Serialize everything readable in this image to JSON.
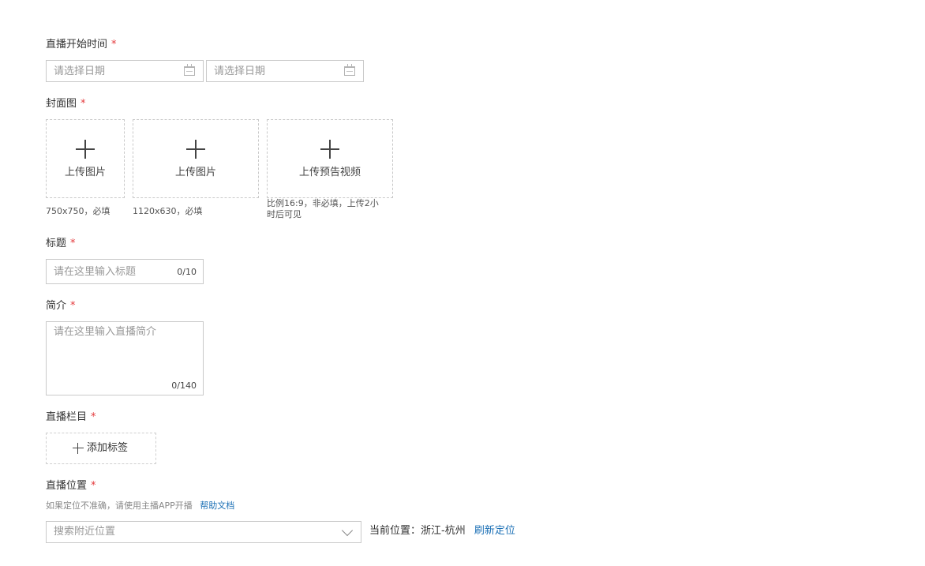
{
  "start_time": {
    "label": "直播开始时间",
    "required_mark": "*",
    "start_placeholder": "请选择日期",
    "end_placeholder": "请选择日期"
  },
  "cover": {
    "label": "封面图",
    "required_mark": "*",
    "uploads": [
      {
        "label": "上传图片",
        "hint": "750x750，必填"
      },
      {
        "label": "上传图片",
        "hint": "1120x630，必填"
      },
      {
        "label": "上传预告视频",
        "hint_line1": "比例16:9，非必填，上传2小",
        "hint_line2": "时后可见"
      }
    ]
  },
  "title": {
    "label": "标题",
    "required_mark": "*",
    "placeholder": "请在这里输入标题",
    "counter": "0/10"
  },
  "intro": {
    "label": "简介",
    "required_mark": "*",
    "placeholder": "请在这里输入直播简介",
    "counter": "0/140"
  },
  "column": {
    "label": "直播栏目",
    "required_mark": "*",
    "add_tag_label": "添加标签"
  },
  "location": {
    "label": "直播位置",
    "required_mark": "*",
    "note": "如果定位不准确，请使用主播APP开播",
    "help_link": "帮助文档",
    "search_placeholder": "搜索附近位置",
    "current_prefix": "当前位置：",
    "current_value": "浙江-杭州",
    "refresh_link": "刷新定位"
  },
  "colors": {
    "required": "#e4393c",
    "link": "#1a6fb5",
    "border": "#c9c9c9"
  }
}
